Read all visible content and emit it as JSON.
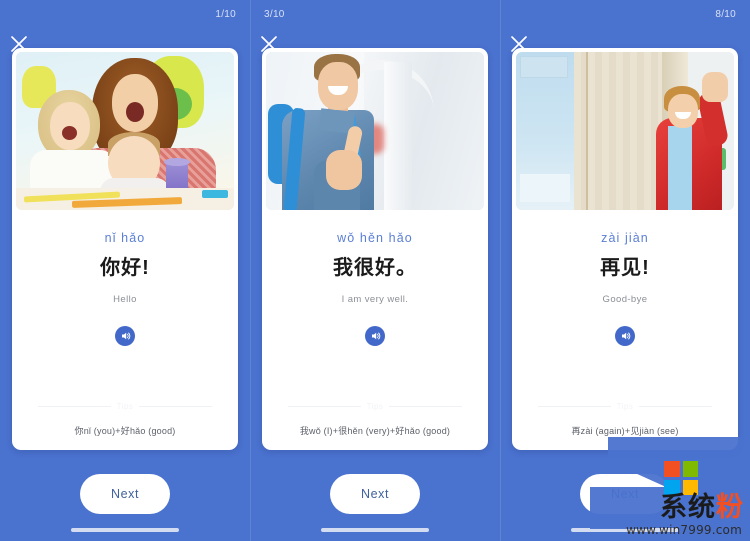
{
  "app": {
    "background_color": "#4a72cf",
    "accent_color": "#4269c9",
    "card_background": "#ffffff"
  },
  "screens": [
    {
      "counter": "1/10",
      "close_icon": "close-icon",
      "photo_alt": "mother and two children with painted hands",
      "pinyin": "nǐ hǎo",
      "hanzi": "你好!",
      "english": "Hello",
      "audio_icon": "sound-wave-icon",
      "tips_label": "Tips",
      "tips_text": "你nǐ (you)+好hǎo (good)",
      "next_label": "Next"
    },
    {
      "counter": "3/10",
      "close_icon": "close-icon",
      "photo_alt": "student with backpack giving thumbs up",
      "pinyin": "wǒ hěn hǎo",
      "hanzi": "我很好。",
      "english": "I am very well.",
      "audio_icon": "sound-wave-icon",
      "tips_label": "Tips",
      "tips_text": "我wǒ (I)+很hěn (very)+好hǎo (good)",
      "next_label": "Next"
    },
    {
      "counter": "8/10",
      "close_icon": "close-icon",
      "photo_alt": "boy in red jacket waving at a door",
      "pinyin": "zài jiàn",
      "hanzi": "再见!",
      "english": "Good-bye",
      "audio_icon": "sound-wave-icon",
      "tips_label": "Tips",
      "tips_text": "再zài (again)+见jiàn (see)",
      "next_label": "Next"
    }
  ],
  "watermark": {
    "title_main": "系统",
    "title_accent": "粉",
    "url": "www.win7999.com",
    "logo_icon": "microsoft-logo-icon"
  }
}
